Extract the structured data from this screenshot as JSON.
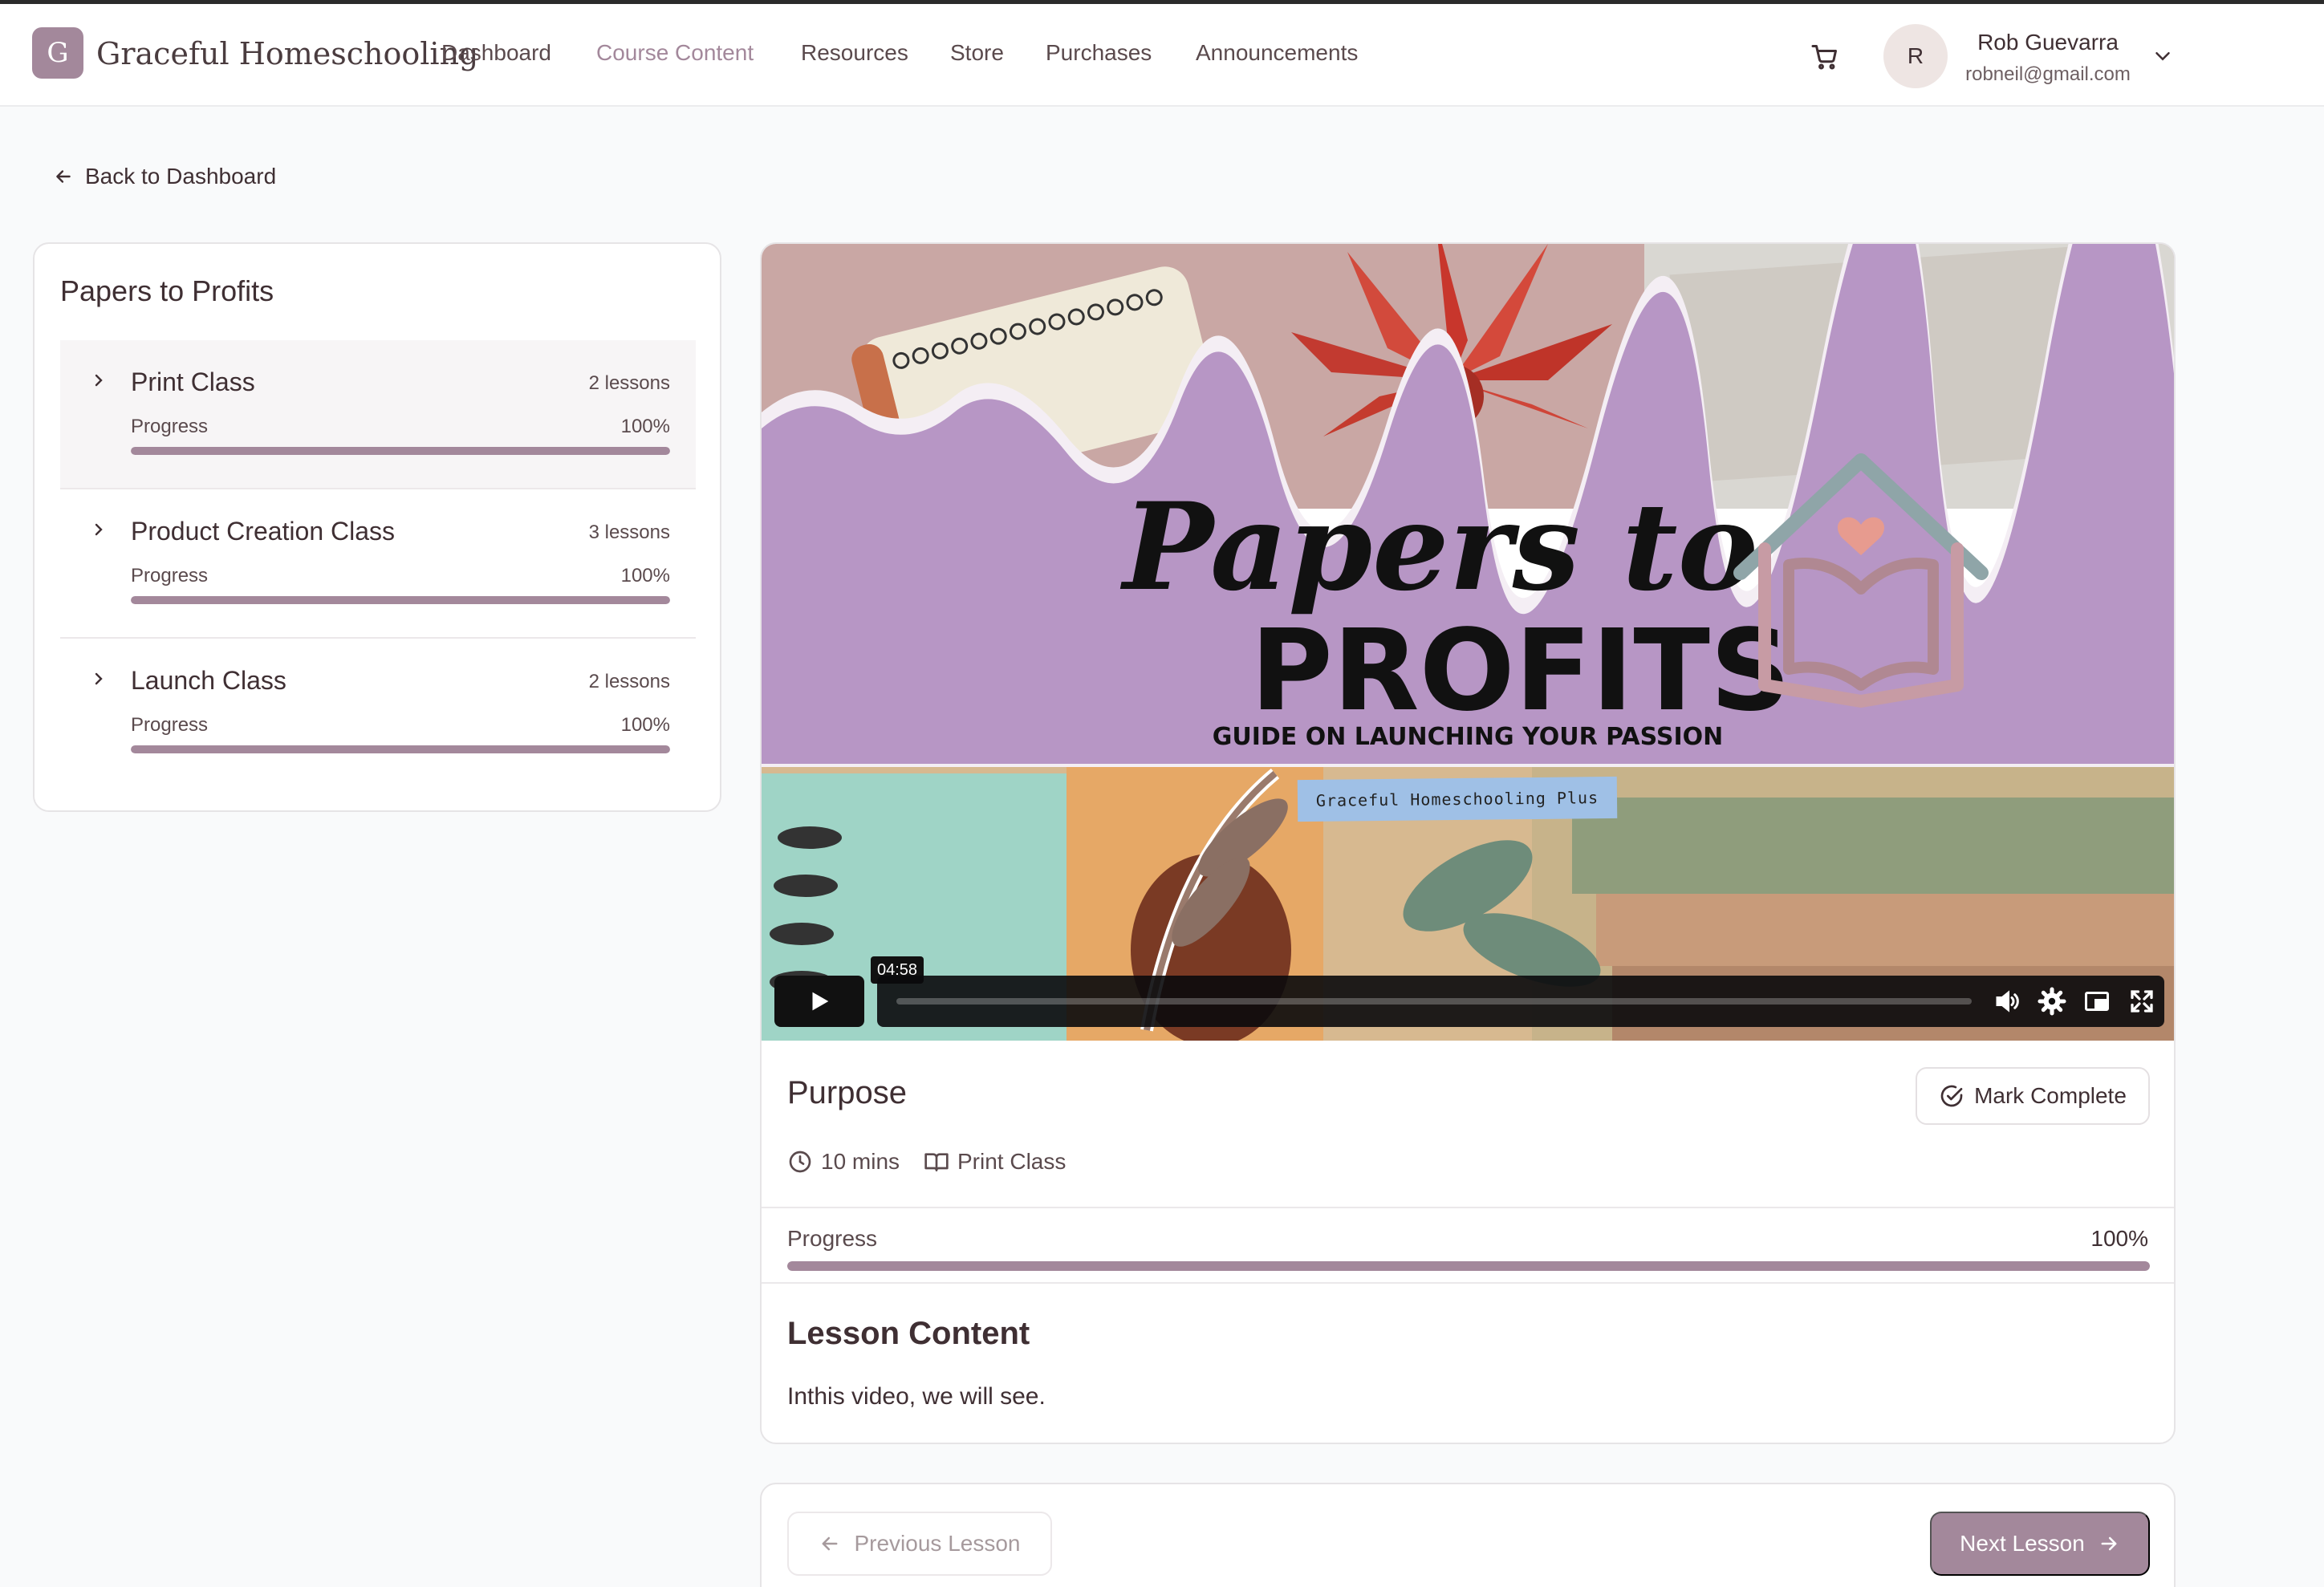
{
  "header": {
    "logo_letter": "G",
    "brand": "Graceful Homeschooling",
    "nav": [
      "Dashboard",
      "Course Content",
      "Resources",
      "Store",
      "Purchases",
      "Announcements"
    ],
    "active_nav": "Course Content",
    "user": {
      "initial": "R",
      "name": "Rob Guevarra",
      "email": "robneil@gmail.com"
    }
  },
  "back_link": "Back to Dashboard",
  "sidebar": {
    "title": "Papers to Profits",
    "modules": [
      {
        "name": "Print Class",
        "lessons": "2 lessons",
        "progress_label": "Progress",
        "progress_text": "100%",
        "progress": 1.0
      },
      {
        "name": "Product Creation Class",
        "lessons": "3 lessons",
        "progress_label": "Progress",
        "progress_text": "100%",
        "progress": 1.0
      },
      {
        "name": "Launch Class",
        "lessons": "2 lessons",
        "progress_label": "Progress",
        "progress_text": "100%",
        "progress": 1.0
      }
    ]
  },
  "video": {
    "title_script": "Papers to",
    "title_caps": "PROFITS",
    "subtitle": "GUIDE ON LAUNCHING YOUR PASSION",
    "label": "Graceful Homeschooling Plus",
    "time": "04:58"
  },
  "lesson": {
    "title": "Purpose",
    "mark_complete": "Mark Complete",
    "duration": "10 mins",
    "module": "Print Class",
    "progress_label": "Progress",
    "progress_text": "100%",
    "progress": 1.0,
    "content_heading": "Lesson Content",
    "content_body": "Inthis video, we will see."
  },
  "pager": {
    "previous": "Previous Lesson",
    "next": "Next Lesson"
  },
  "colors": {
    "accent": "#a3889b",
    "banner": "#b796c5",
    "text": "#3f2f33"
  }
}
